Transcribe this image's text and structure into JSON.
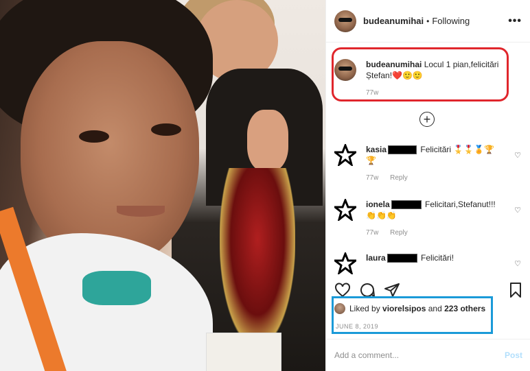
{
  "header": {
    "username": "budeanumihai",
    "separator": "•",
    "follow_status": "Following",
    "more_icon": "more-horizontal-icon"
  },
  "caption": {
    "username": "budeanumihai",
    "text": "Locul 1 pian,felicitări Ștefan!",
    "emojis": "❤️🙂🙂",
    "timestamp": "77w"
  },
  "comments": [
    {
      "username": "kasia",
      "text": "Felicitări",
      "emojis": "🎖️🎖️🏅🏆🏆",
      "timestamp": "77w",
      "reply_label": "Reply"
    },
    {
      "username": "ionela",
      "text": "Felicitari,Stefanut!!!",
      "emojis": "👏👏👏",
      "timestamp": "77w",
      "reply_label": "Reply"
    },
    {
      "username": "laura",
      "text": "Felicitări!",
      "emojis": ""
    }
  ],
  "likes": {
    "prefix": "Liked by",
    "liker": "viorelsipos",
    "conjunction": "and",
    "others": "223 others"
  },
  "post_date": "JUNE 8, 2019",
  "add_comment": {
    "placeholder": "Add a comment...",
    "post_label": "Post"
  },
  "colors": {
    "caption_highlight": "#e0262c",
    "likes_highlight": "#1a9ad8",
    "post_disabled": "#b2dffc"
  }
}
